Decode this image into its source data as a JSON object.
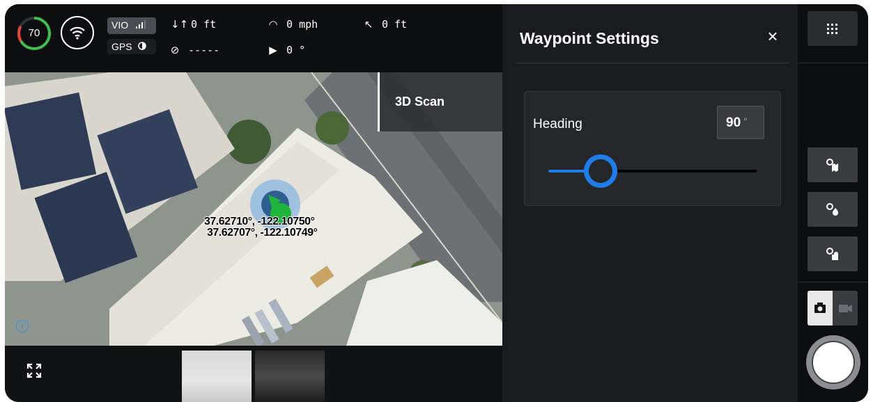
{
  "telemetry": {
    "battery_percent": "70",
    "vio_label": "VIO",
    "gps_label": "GPS",
    "altitude_label": "0 ft",
    "speed_label": "0 mph",
    "distance_label": "0 ft",
    "heading_readout": "-----",
    "gimbal_label": "0 °"
  },
  "map": {
    "mode_tab_label": "3D Scan",
    "coordinate_line_1": "37.62710°, -122.10750°",
    "coordinate_line_2": "37.62707°, -122.10749°",
    "info_icon": "info-icon"
  },
  "panel": {
    "title": "Waypoint Settings",
    "close_label": "×",
    "heading_label": "Heading",
    "heading_value": "90",
    "heading_unit": "°",
    "heading_slider_fraction": 0.25
  },
  "rail": {
    "tools": [
      "map-settings-icon",
      "fire-settings-icon",
      "shape-settings-icon"
    ],
    "capture_mode": "photo"
  },
  "colors": {
    "accent": "#1e7de8",
    "battery_ring": "#3fbf4f",
    "battery_ring_alt": "#e8443a",
    "waypoint": "#1fb53a",
    "waypoint_halo": "#6aa6e6"
  }
}
